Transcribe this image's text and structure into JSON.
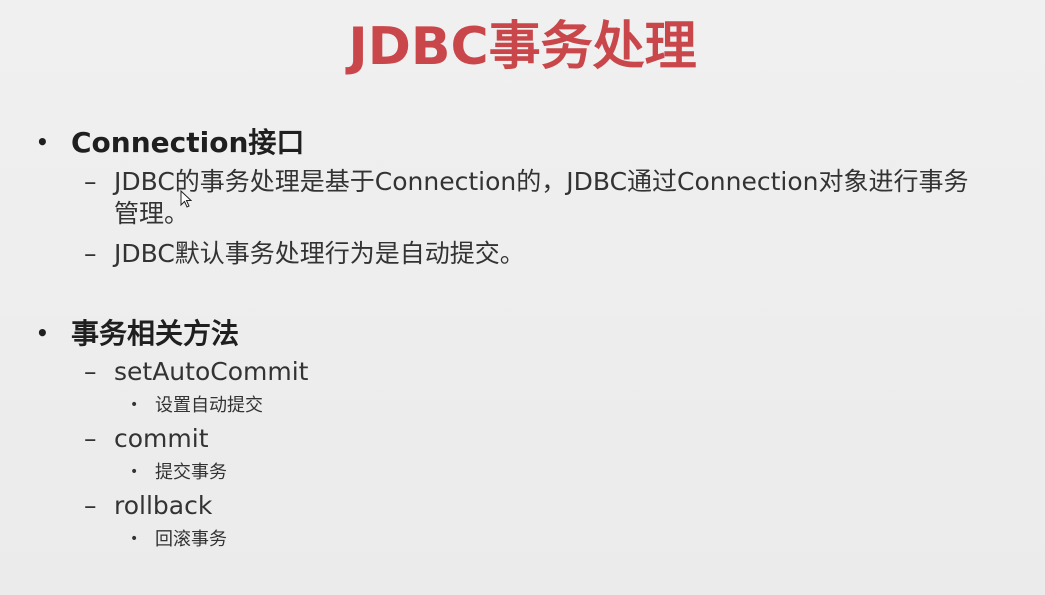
{
  "slide": {
    "title": "JDBC事务处理",
    "sections": [
      {
        "heading": "Connection接口",
        "items": [
          "JDBC的事务处理是基于Connection的，JDBC通过Connection对象进行事务管理。",
          "JDBC默认事务处理行为是自动提交。"
        ]
      },
      {
        "heading": "事务相关方法",
        "methods": [
          {
            "name": "setAutoCommit",
            "desc": "设置自动提交"
          },
          {
            "name": "commit",
            "desc": "提交事务"
          },
          {
            "name": "rollback",
            "desc": "回滚事务"
          }
        ]
      }
    ],
    "markers": {
      "level1": "•",
      "level2": "–",
      "level3": "•"
    }
  },
  "colors": {
    "title": "#c9474a",
    "background": "#efefef",
    "text": "#2b2b2b"
  }
}
